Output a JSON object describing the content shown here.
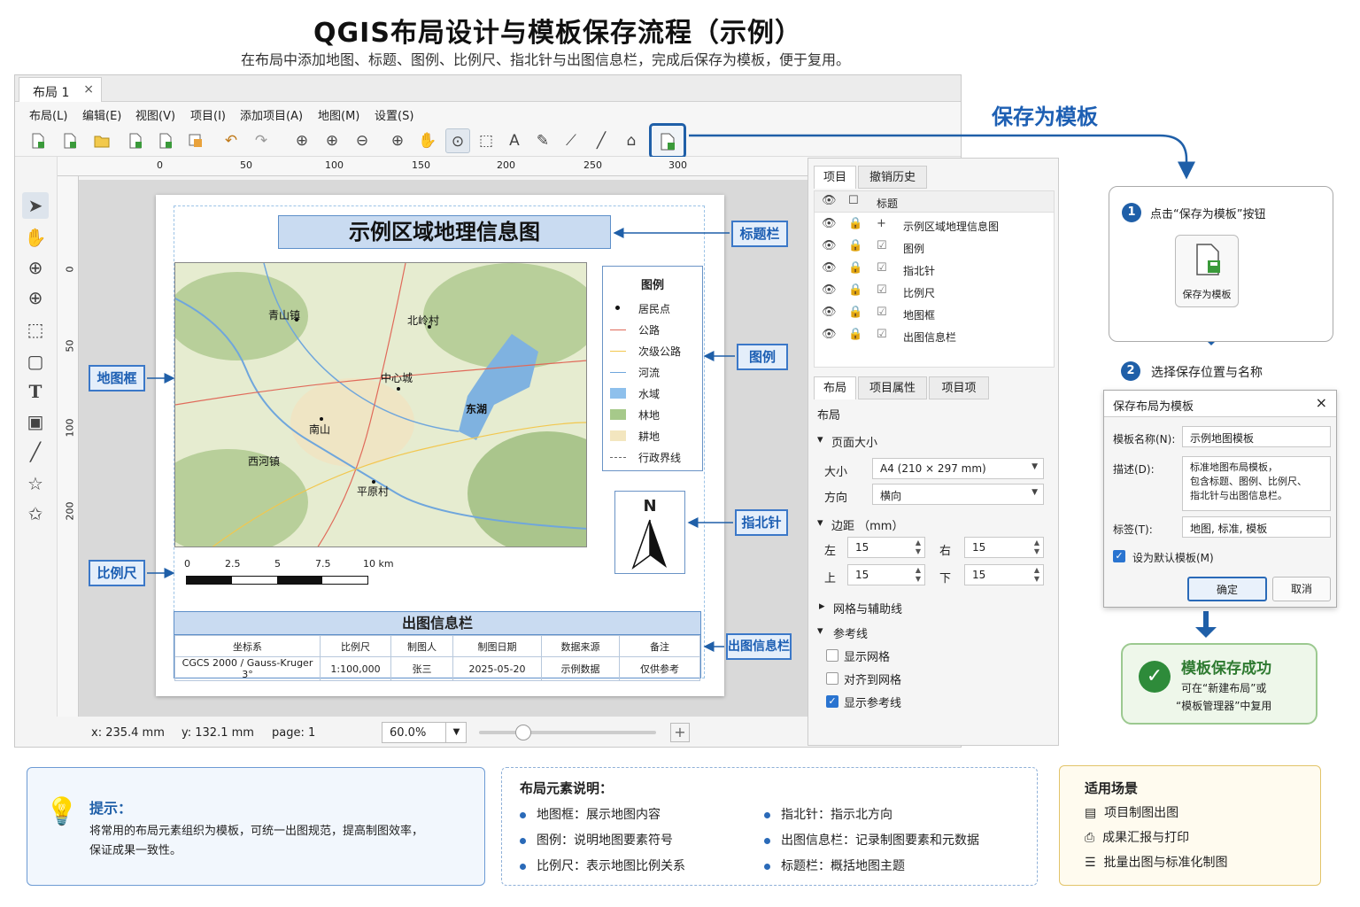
{
  "header": {
    "title": "QGIS布局设计与模板保存流程（示例）",
    "subtitle": "在布局中添加地图、标题、图例、比例尺、指北针与出图信息栏，完成后保存为模板，便于复用。"
  },
  "window": {
    "tab_label": "布局 1",
    "tab_close": "×",
    "menu": [
      "布局(L)",
      "编辑(E)",
      "视图(V)",
      "项目(I)",
      "添加项目(A)",
      "地图(M)",
      "设置(S)"
    ]
  },
  "ruler": {
    "top_ticks": [
      "0",
      "50",
      "100",
      "150",
      "200",
      "250",
      "300"
    ],
    "left_ticks": [
      "0",
      "50",
      "100",
      "200"
    ]
  },
  "layout": {
    "map_title": "示例区域地理信息图",
    "places": [
      "青山镇",
      "北岭村",
      "中心城",
      "东湖",
      "南山",
      "西河镇",
      "平原村"
    ],
    "legend_title": "图例",
    "legend_items": [
      "居民点",
      "公路",
      "次级公路",
      "河流",
      "水域",
      "林地",
      "耕地",
      "行政界线"
    ],
    "north_label": "N",
    "scale_labels": [
      "0",
      "2.5",
      "5",
      "7.5",
      "10 km"
    ],
    "info_title": "出图信息栏",
    "info_headers": [
      "坐标系",
      "比例尺",
      "制图人",
      "制图日期",
      "数据来源",
      "备注"
    ],
    "info_values": [
      "CGCS 2000 / Gauss-Kruger 3°",
      "1:100,000",
      "张三",
      "2025-05-20",
      "示例数据",
      "仅供参考"
    ]
  },
  "callouts": {
    "title_bar": "标题栏",
    "legend": "图例",
    "map_frame": "地图框",
    "north_arrow": "指北针",
    "scale_bar": "比例尺",
    "info_bar": "出图信息栏"
  },
  "status": {
    "x": "x: 235.4 mm",
    "y": "y: 132.1 mm",
    "page": "page:  1",
    "zoom": "60.0%",
    "zoom_fraction": 0.25
  },
  "panel": {
    "tabs_top": [
      "项目",
      "撤销历史"
    ],
    "list_header": "标题",
    "items": [
      "示例区域地理信息图",
      "图例",
      "指北针",
      "比例尺",
      "地图框",
      "出图信息栏"
    ],
    "tabs_bottom": [
      "布局",
      "项目属性",
      "项目项"
    ],
    "section_label": "布局",
    "page_size_heading": "页面大小",
    "size_label": "大小",
    "size_value": "A4 (210 × 297 mm)",
    "orientation_label": "方向",
    "orientation_value": "横向",
    "margins_heading": "边距 （mm）",
    "left_label": "左",
    "left_value": "15",
    "right_label": "右",
    "right_value": "15",
    "top_label": "上",
    "top_value": "15",
    "bottom_label": "下",
    "bottom_value": "15",
    "grid_heading": "网格与辅助线",
    "guides_heading": "参考线",
    "show_grid": "显示网格",
    "snap_grid": "对齐到网格",
    "show_guides": "显示参考线"
  },
  "workflow": {
    "heading": "保存为模板",
    "step1_num": "1",
    "step1_text": "点击“保存为模板”按钮",
    "save_button_label": "保存为模板",
    "step2_num": "2",
    "step2_text": "选择保存位置与名称",
    "dialog_title": "保存布局为模板",
    "dialog_close": "×",
    "name_label": "模板名称(N):",
    "name_value": "示例地图模板",
    "desc_label": "描述(D):",
    "desc_line1": "标准地图布局模板，",
    "desc_line2": "包含标题、图例、比例尺、",
    "desc_line3": "指北针与出图信息栏。",
    "tags_label": "标签(T):",
    "tags_value": "地图, 标准, 模板",
    "default_label": "设为默认模板(M)",
    "ok": "确定",
    "cancel": "取消",
    "success_title": "模板保存成功",
    "success_line1": "可在“新建布局”或",
    "success_line2": "“模板管理器”中复用"
  },
  "tip": {
    "title": "提示：",
    "line1": "将常用的布局元素组织为模板，可统一出图规范，提高制图效率，",
    "line2": "保证成果一致性。"
  },
  "elements": {
    "title": "布局元素说明：",
    "items": [
      "地图框：展示地图内容",
      "图例：说明地图要素符号",
      "比例尺：表示地图比例关系",
      "指北针：指示北方向",
      "出图信息栏：记录制图要素和元数据",
      "标题栏：概括地图主题"
    ]
  },
  "scenes": {
    "title": "适用场景",
    "items": [
      "项目制图出图",
      "成果汇报与打印",
      "批量出图与标准化制图"
    ]
  },
  "colors": {
    "accent": "#1f5fa8",
    "callout_bg": "#e4eefa",
    "success_green": "#2e8b3a"
  }
}
